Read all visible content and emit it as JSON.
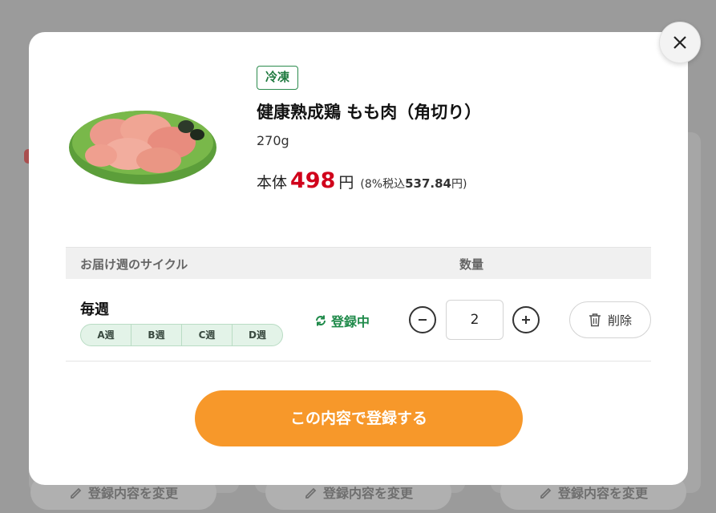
{
  "product": {
    "badge": "冷凍",
    "name": "健康熟成鶏 もも肉（角切り）",
    "weight": "270g",
    "price_label": "本体",
    "price": "498",
    "price_unit": "円",
    "tax_prefix": "(8%税込",
    "tax_price": "537.84",
    "tax_suffix": "円)"
  },
  "table": {
    "col_cycle": "お届け週のサイクル",
    "col_quantity": "数量"
  },
  "row": {
    "cycle": "毎週",
    "weeks": [
      "A週",
      "B週",
      "C週",
      "D週"
    ],
    "status": "登録中",
    "quantity": "2",
    "delete_label": "削除"
  },
  "submit_label": "この内容で登録する",
  "background": {
    "edit_label": "登録内容を変更"
  },
  "colors": {
    "accent_orange": "#f7982a",
    "price_red": "#d0021b",
    "status_green": "#1f8a4a"
  }
}
